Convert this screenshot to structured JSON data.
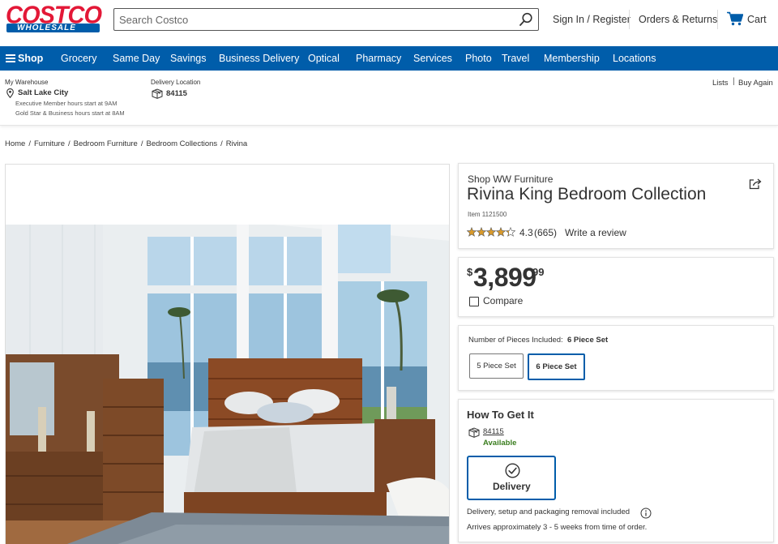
{
  "header": {
    "logo_primary": "COSTCO",
    "logo_secondary": "WHOLESALE",
    "search_placeholder": "Search Costco",
    "sign_in": "Sign In / Register",
    "orders": "Orders & Returns",
    "cart": "Cart"
  },
  "nav": {
    "shop": "Shop",
    "items": [
      "Grocery",
      "Same Day",
      "Savings",
      "Business Delivery",
      "Optical",
      "Pharmacy",
      "Services",
      "Photo",
      "Travel",
      "Membership",
      "Locations"
    ]
  },
  "location": {
    "warehouse_label": "My Warehouse",
    "warehouse_name": "Salt Lake City",
    "exec_hours": "Executive Member hours start at 9AM",
    "gold_hours": "Gold Star & Business hours start at 8AM",
    "delivery_label": "Delivery Location",
    "delivery_zip": "84115",
    "lists": "Lists",
    "buy_again": "Buy Again"
  },
  "breadcrumb": [
    "Home",
    "Furniture",
    "Bedroom Furniture",
    "Bedroom Collections",
    "Rivina"
  ],
  "product": {
    "shop_link": "Shop WW Furniture",
    "title": "Rivina King Bedroom Collection",
    "item_number": "Item 1121500",
    "rating": "4.3",
    "rating_value": 4.3,
    "review_count": "(665)",
    "write_review": "Write a review",
    "price_currency": "$",
    "price_main": "3,899",
    "price_cents": "99",
    "compare": "Compare"
  },
  "pieces": {
    "label": "Number of Pieces Included:",
    "selected": "6 Piece Set",
    "options": [
      "5 Piece Set",
      "6 Piece Set"
    ]
  },
  "get_it": {
    "heading": "How To Get It",
    "zip": "84115",
    "availability": "Available",
    "delivery_option": "Delivery",
    "delivery_note": "Delivery, setup and packaging removal included",
    "arrival_note": "Arrives approximately 3 - 5 weeks from time of order."
  },
  "colors": {
    "brand_blue": "#005daa",
    "brand_red": "#e31837",
    "available_green": "#3a7d1e",
    "star_gold": "#d99a2b"
  }
}
